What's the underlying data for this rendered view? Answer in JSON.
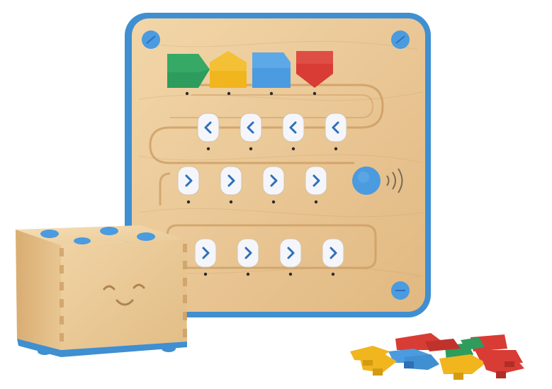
{
  "scene": {
    "description_label": "",
    "colors": {
      "background": "#ffffff",
      "wood_light": "#f0d3a4",
      "wood_mid": "#e6c08a",
      "wood_dark": "#c99a5f",
      "frame_blue": "#3f8fd1",
      "button_blue": "#4a9be0",
      "slot_white": "#f4f6fb",
      "chevron_blue": "#2f6fb7",
      "block_green": "#2e9c5c",
      "block_yellow": "#f1b51e",
      "block_blue": "#4a9be0",
      "block_red": "#d83c34"
    },
    "board": {
      "top_blocks": [
        "green",
        "yellow",
        "blue",
        "red"
      ],
      "rows": [
        {
          "name": "row-1",
          "direction": "left",
          "count": 4
        },
        {
          "name": "row-2",
          "direction": "right",
          "count": 4
        },
        {
          "name": "row-3",
          "direction": "right",
          "count": 4
        }
      ],
      "has_go_button": true
    },
    "robot": {
      "face": "smile",
      "top_dots": 4
    },
    "loose_blocks": {
      "colors": [
        "red",
        "green",
        "yellow",
        "blue",
        "red",
        "yellow",
        "green",
        "blue",
        "red",
        "yellow",
        "red"
      ]
    }
  }
}
